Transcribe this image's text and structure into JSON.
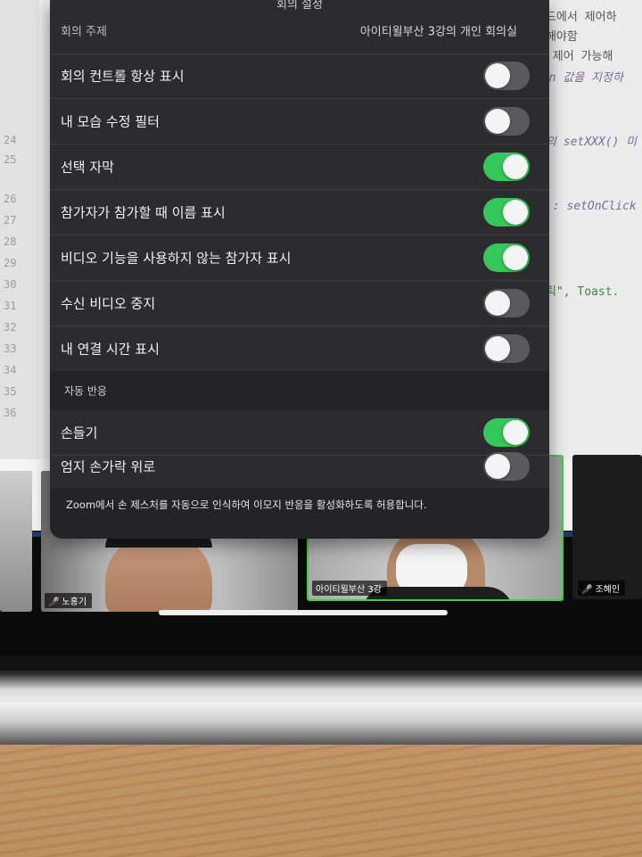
{
  "settings_panel": {
    "header_title": "회의 설정",
    "meeting_topic": {
      "label": "회의 주제",
      "value": "아이티윌부산 3강의 개인 회의실"
    },
    "toggles": [
      {
        "label": "회의 컨트롤 항상 표시",
        "on": false
      },
      {
        "label": "내 모습 수정 필터",
        "on": false
      },
      {
        "label": "선택 자막",
        "on": true
      },
      {
        "label": "참가자가 참가할 때 이름 표시",
        "on": true
      },
      {
        "label": "비디오 기능을 사용하지 않는 참가자 표시",
        "on": true
      },
      {
        "label": "수신 비디오 중지",
        "on": false
      },
      {
        "label": "내 연결 시간 표시",
        "on": false
      }
    ],
    "section_auto_reactions": {
      "title": "자동 반응",
      "toggles": [
        {
          "label": "손들기",
          "on": true
        },
        {
          "label": "엄지 손가락 위로",
          "on": false
        }
      ],
      "note": "Zoom에서 손 제스처를 자동으로 인식하여 이모지 반응을 활성화하도록 허용합니다."
    }
  },
  "participants": [
    {
      "name": "노홍기",
      "muted": true
    },
    {
      "name": "아이티윌부산 3강",
      "muted": false,
      "active_speaker": true
    },
    {
      "name": "조혜인",
      "muted": true
    }
  ],
  "editor": {
    "line_numbers": [
      "24",
      "25",
      "26",
      "27",
      "28",
      "29",
      "30",
      "31",
      "32",
      "33",
      "34",
      "35",
      "36"
    ],
    "code_fragments": [
      "코드에서 제어하",
      "정해야함",
      "및 제어 가능해",
      "btn 값을 지정하",
      "체의 setXXX() 미",
      "름 : setOnClick",
      "클릭\", Toast."
    ]
  },
  "colors": {
    "panel_bg": "#2c2c2e",
    "toggle_on": "#35c759",
    "toggle_off": "#5a5a5e",
    "active_speaker_border": "#3ecf3e",
    "muted_icon": "#e23a3a"
  }
}
